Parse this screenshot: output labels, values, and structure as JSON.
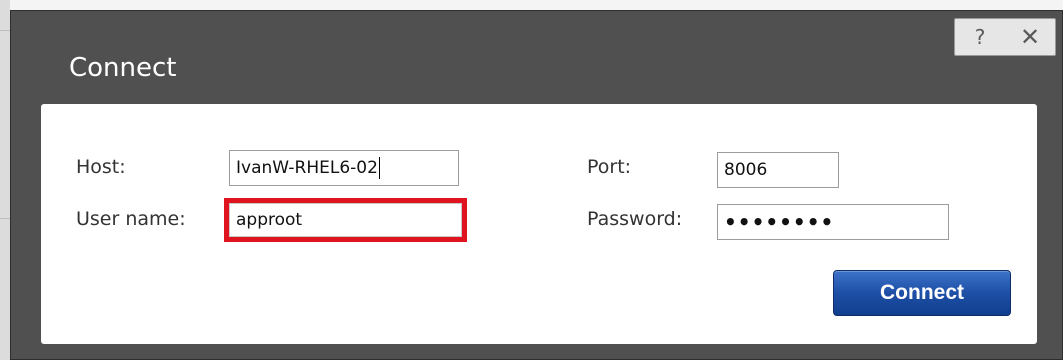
{
  "dialog": {
    "title": "Connect",
    "help_label": "?",
    "close_label": "✕"
  },
  "form": {
    "host_label": "Host:",
    "host_value": "IvanW-RHEL6-02",
    "port_label": "Port:",
    "port_value": "8006",
    "username_label": "User name:",
    "username_value": "approot",
    "password_label": "Password:",
    "password_masked": "••••••••",
    "connect_label": "Connect"
  },
  "colors": {
    "dialog_bg": "#505050",
    "highlight": "#e0141e",
    "button_blue": "#1d4fa6"
  }
}
